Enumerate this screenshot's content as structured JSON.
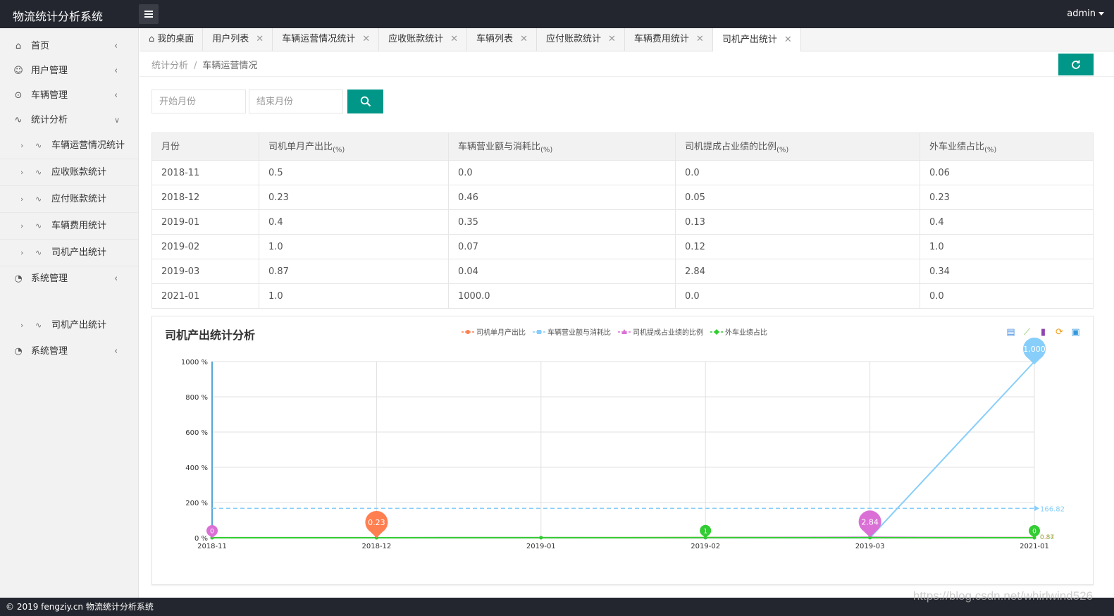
{
  "app": {
    "title": "物流统计分析系统",
    "user": "admin"
  },
  "sidebar": {
    "items": [
      {
        "label": "首页",
        "icon": "home-icon"
      },
      {
        "label": "用户管理",
        "icon": "user-icon"
      },
      {
        "label": "车辆管理",
        "icon": "vehicle-icon"
      },
      {
        "label": "统计分析",
        "icon": "pulse-icon"
      }
    ],
    "sub_items": [
      "车辆运营情况统计",
      "应收账款统计",
      "应付账款统计",
      "车辆费用统计",
      "司机产出统计"
    ],
    "system_label": "系统管理",
    "extra_sub_item": "司机产出统计",
    "system_label_2": "系统管理"
  },
  "tabs": [
    "我的桌面",
    "用户列表",
    "车辆运营情况统计",
    "应收账款统计",
    "车辆列表",
    "应付账款统计",
    "车辆费用统计",
    "司机产出统计"
  ],
  "breadcrumb": {
    "parent": "统计分析",
    "separator": "/",
    "current": "车辆运营情况"
  },
  "search": {
    "start_placeholder": "开始月份",
    "end_placeholder": "结束月份"
  },
  "table": {
    "headers": [
      {
        "text": "月份",
        "unit": ""
      },
      {
        "text": "司机单月产出比",
        "unit": "(%)"
      },
      {
        "text": "车辆营业额与消耗比",
        "unit": "(%)"
      },
      {
        "text": "司机提成占业绩的比例",
        "unit": "(%)"
      },
      {
        "text": "外车业绩占比",
        "unit": "(%)"
      }
    ],
    "rows": [
      [
        "2018-11",
        "0.5",
        "0.0",
        "0.0",
        "0.06"
      ],
      [
        "2018-12",
        "0.23",
        "0.46",
        "0.05",
        "0.23"
      ],
      [
        "2019-01",
        "0.4",
        "0.35",
        "0.13",
        "0.4"
      ],
      [
        "2019-02",
        "1.0",
        "0.07",
        "0.12",
        "1.0"
      ],
      [
        "2019-03",
        "0.87",
        "0.04",
        "2.84",
        "0.34"
      ],
      [
        "2021-01",
        "1.0",
        "1000.0",
        "0.0",
        "0.0"
      ]
    ]
  },
  "chart_data": {
    "type": "line",
    "title": "司机产出统计分析",
    "categories": [
      "2018-11",
      "2018-12",
      "2019-01",
      "2019-02",
      "2019-03",
      "2021-01"
    ],
    "ylim": [
      0,
      1000
    ],
    "yticks": [
      0,
      200,
      400,
      600,
      800,
      1000
    ],
    "ytick_suffix": " %",
    "grid": true,
    "legend_position": "top",
    "series": [
      {
        "name": "司机单月产出比",
        "color": "#ff7f50",
        "marker": "circle",
        "values": [
          0.5,
          0.23,
          0.4,
          1.0,
          0.87,
          1.0
        ],
        "max_pin": "0.23",
        "max_pin_index": 1
      },
      {
        "name": "车辆营业额与消耗比",
        "color": "#87cefa",
        "marker": "square",
        "values": [
          0.0,
          0.46,
          0.35,
          0.07,
          0.04,
          1000.0
        ],
        "max_pin": "1,000",
        "max_pin_index": 5,
        "average": "166.82"
      },
      {
        "name": "司机提成占业绩的比例",
        "color": "#da70d6",
        "marker": "triangle",
        "values": [
          0.0,
          0.05,
          0.13,
          0.12,
          2.84,
          0.0
        ],
        "max_pin": "2.84",
        "max_pin_index": 4,
        "min_pin": "0",
        "min_pin_index": 0
      },
      {
        "name": "外车业绩占比",
        "color": "#32cd32",
        "marker": "diamond",
        "values": [
          0.06,
          0.23,
          0.4,
          1.0,
          0.34,
          0.0
        ],
        "max_pin": "1",
        "max_pin_index": 3,
        "min_pin": "0",
        "min_pin_index": 5
      }
    ],
    "end_labels": [
      "0.87",
      "0.34"
    ]
  },
  "footer": {
    "text": "© 2019 fengziy.cn 物流统计分析系统"
  },
  "watermark": "https://blog.csdn.net/whirlwind526"
}
